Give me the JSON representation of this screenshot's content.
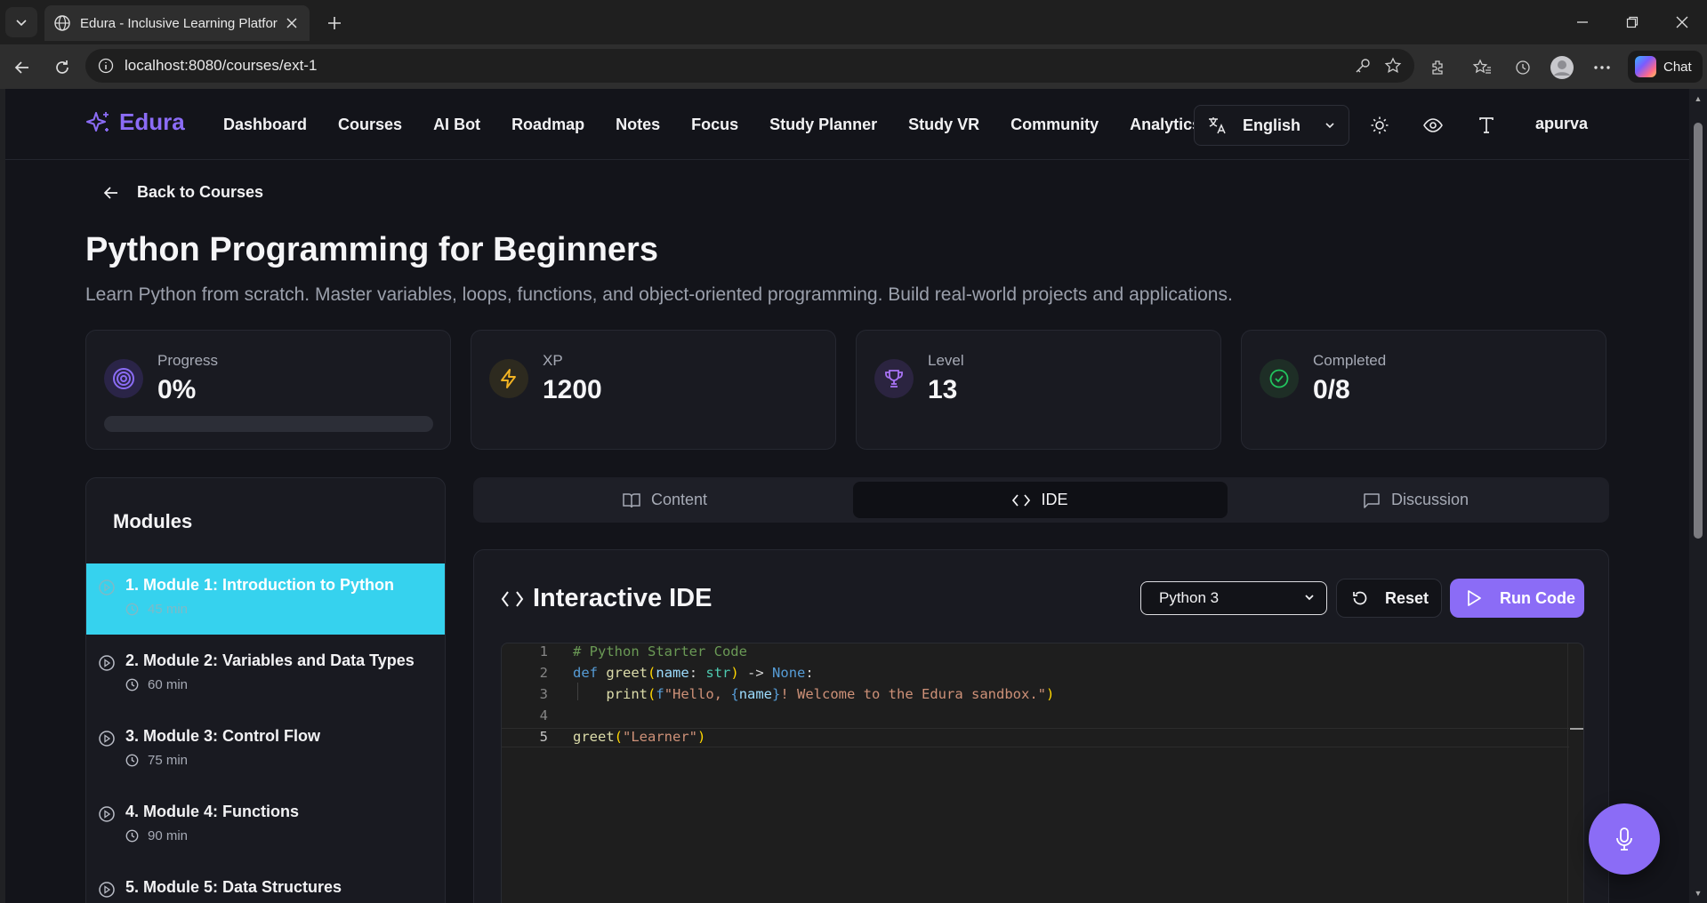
{
  "browser": {
    "tab_title": "Edura - Inclusive Learning Platform",
    "url": "localhost:8080/courses/ext-1",
    "copilot_label": "Chat"
  },
  "app": {
    "brand": "Edura",
    "nav": [
      "Dashboard",
      "Courses",
      "AI Bot",
      "Roadmap",
      "Notes",
      "Focus",
      "Study Planner",
      "Study VR",
      "Community",
      "Analytics"
    ],
    "language": "English",
    "user": "apurva",
    "accent": "#8b6cf6"
  },
  "course": {
    "back_label": "Back to Courses",
    "title": "Python Programming for Beginners",
    "subtitle": "Learn Python from scratch. Master variables, loops, functions, and object-oriented programming. Build real-world projects and applications."
  },
  "stats": [
    {
      "label": "Progress",
      "value": "0%",
      "icon": "target-icon",
      "progress_fraction": 0
    },
    {
      "label": "XP",
      "value": "1200",
      "icon": "lightning-icon"
    },
    {
      "label": "Level",
      "value": "13",
      "icon": "trophy-icon"
    },
    {
      "label": "Completed",
      "value": "0/8",
      "icon": "check-circle-icon"
    }
  ],
  "modules": {
    "heading": "Modules",
    "items": [
      {
        "title": "1. Module 1: Introduction to Python",
        "duration": "45 min",
        "active": true
      },
      {
        "title": "2. Module 2: Variables and Data Types",
        "duration": "60 min"
      },
      {
        "title": "3. Module 3: Control Flow",
        "duration": "75 min"
      },
      {
        "title": "4. Module 4: Functions",
        "duration": "90 min"
      },
      {
        "title": "5. Module 5: Data Structures",
        "duration": ""
      }
    ]
  },
  "tabs": [
    {
      "label": "Content",
      "icon": "book-icon"
    },
    {
      "label": "IDE",
      "icon": "code-icon",
      "selected": true
    },
    {
      "label": "Discussion",
      "icon": "message-icon"
    }
  ],
  "ide": {
    "title": "Interactive IDE",
    "language": "Python 3",
    "reset_label": "Reset",
    "run_label": "Run Code",
    "line_numbers": [
      "1",
      "2",
      "3",
      "4",
      "5"
    ],
    "code_lines": [
      "# Python Starter Code",
      "def greet(name: str) -> None:",
      "    print(f\"Hello, {name}! Welcome to the Edura sandbox.\")",
      "",
      "greet(\"Learner\")"
    ],
    "cursor_line": 5
  }
}
